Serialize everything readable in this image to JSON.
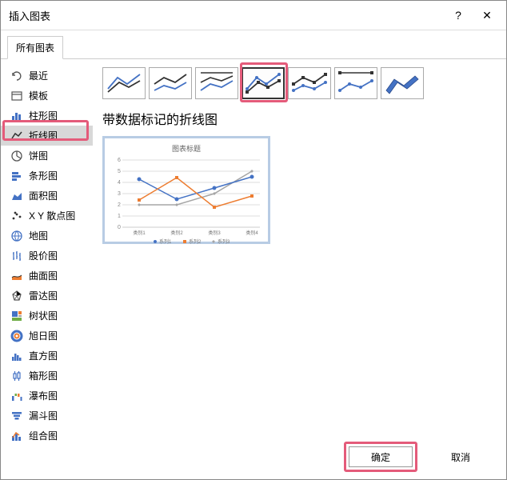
{
  "dialog": {
    "title": "插入图表"
  },
  "tabs": {
    "all": "所有图表"
  },
  "sidebar": {
    "items": [
      {
        "label": "最近"
      },
      {
        "label": "模板"
      },
      {
        "label": "柱形图"
      },
      {
        "label": "折线图"
      },
      {
        "label": "饼图"
      },
      {
        "label": "条形图"
      },
      {
        "label": "面积图"
      },
      {
        "label": "X Y 散点图"
      },
      {
        "label": "地图"
      },
      {
        "label": "股价图"
      },
      {
        "label": "曲面图"
      },
      {
        "label": "雷达图"
      },
      {
        "label": "树状图"
      },
      {
        "label": "旭日图"
      },
      {
        "label": "直方图"
      },
      {
        "label": "箱形图"
      },
      {
        "label": "瀑布图"
      },
      {
        "label": "漏斗图"
      },
      {
        "label": "组合图"
      }
    ],
    "active_index": 3
  },
  "subtypes": {
    "selected_index": 3
  },
  "main": {
    "subtitle": "带数据标记的折线图",
    "preview_title": "图表标题",
    "categories": [
      "类别1",
      "类别2",
      "类别3",
      "类别4"
    ],
    "series_names": [
      "系列1",
      "系列2",
      "系列3"
    ]
  },
  "chart_data": {
    "type": "line",
    "title": "图表标题",
    "xlabel": "",
    "ylabel": "",
    "ylim": [
      0,
      6
    ],
    "categories": [
      "类别1",
      "类别2",
      "类别3",
      "类别4"
    ],
    "series": [
      {
        "name": "系列1",
        "values": [
          4.3,
          2.5,
          3.5,
          4.5
        ],
        "color": "#4472c4"
      },
      {
        "name": "系列2",
        "values": [
          2.4,
          4.4,
          1.8,
          2.8
        ],
        "color": "#ed7d31"
      },
      {
        "name": "系列3",
        "values": [
          2.0,
          2.0,
          3.0,
          5.0
        ],
        "color": "#a5a5a5"
      }
    ]
  },
  "footer": {
    "ok": "确定",
    "cancel": "取消"
  }
}
